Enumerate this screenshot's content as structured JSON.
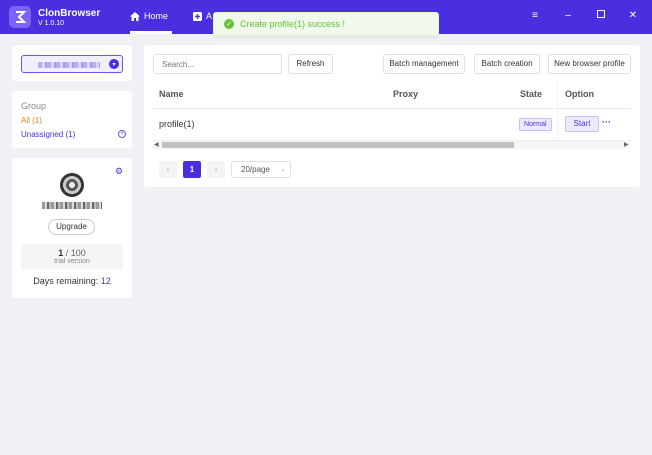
{
  "app": {
    "name": "ClonBrowser",
    "version": "V 1.0.10"
  },
  "nav": {
    "home_label": "Home",
    "add_label": "A"
  },
  "toast": {
    "message": "Create profile(1) success !"
  },
  "group": {
    "title": "Group",
    "all_label": "All",
    "all_count": "(1)",
    "unassigned_label": "Unassigned",
    "unassigned_count": "(1)"
  },
  "account": {
    "upgrade_label": "Upgrade",
    "used": "1",
    "limit": "/ 100",
    "plan": "trial version",
    "days_label": "Days remaining:",
    "days_value": "12"
  },
  "toolbar": {
    "search_placeholder": "Search...",
    "refresh": "Refresh",
    "batch_management": "Batch management",
    "batch_creation": "Batch creation",
    "new_profile": "New browser profile"
  },
  "table": {
    "headers": {
      "name": "Name",
      "proxy": "Proxy",
      "state": "State",
      "option": "Option"
    },
    "rows": [
      {
        "name": "profile(1)",
        "proxy": "",
        "state": "Normal",
        "action": "Start"
      }
    ]
  },
  "pagination": {
    "current": "1",
    "page_size": "20/page"
  },
  "colors": {
    "brand": "#4a2fe0",
    "success": "#67c23a",
    "warning": "#d58b1a"
  }
}
